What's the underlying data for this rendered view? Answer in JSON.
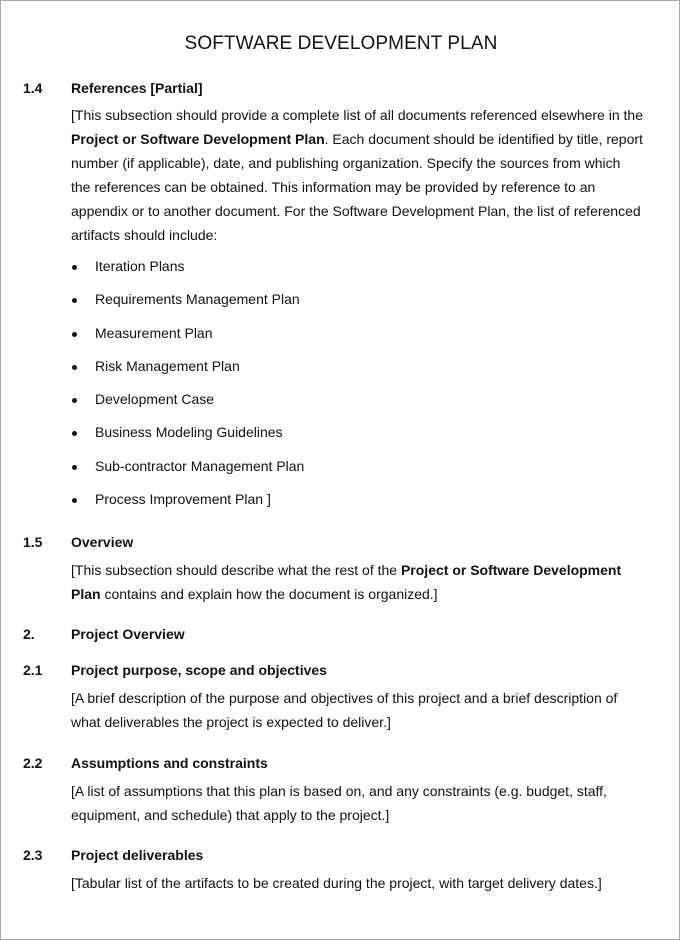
{
  "document": {
    "title": "SOFTWARE DEVELOPMENT PLAN",
    "sections": [
      {
        "number": "1.4",
        "heading": "References [Partial]",
        "lines": [
          [
            {
              "t": "[This subsection should provide a complete list of all documents referenced elsewhere in the",
              "b": false
            }
          ],
          [
            {
              "t": "Project or Software Development Plan",
              "b": true
            },
            {
              "t": ".  Each document should be identified by title, report",
              "b": false
            }
          ],
          [
            {
              "t": "number (if applicable), date,  and publishing organization.  Specify the sources from which",
              "b": false
            }
          ],
          [
            {
              "t": "the references can be obtained. This information may  be provided by reference to an",
              "b": false
            }
          ],
          [
            {
              "t": "appendix or to another document.  For the Software Development Plan,  the list of referenced",
              "b": false
            }
          ],
          [
            {
              "t": "artifacts should include:",
              "b": false
            }
          ]
        ],
        "bullets": [
          "Iteration Plans",
          "Requirements Management Plan",
          "Measurement Plan",
          "Risk Management  Plan",
          "Development Case",
          "Business Modeling Guidelines",
          "Sub-contractor Management Plan",
          "Process Improvement Plan  ]"
        ]
      },
      {
        "number": "1.5",
        "heading": "Overview",
        "lines": [
          [
            {
              "t": "[This subsection should describe what the rest of the ",
              "b": false
            },
            {
              "t": "Project or Software Development",
              "b": true
            }
          ],
          [
            {
              "t": "Plan",
              "b": true
            },
            {
              "t": " contains and explain how the document is organized.]",
              "b": false
            }
          ]
        ]
      },
      {
        "number": "2.",
        "heading": "Project Overview",
        "lines": []
      },
      {
        "number": "2.1",
        "heading": "Project purpose, scope and objectives",
        "lines": [
          [
            {
              "t": "[A brief description of the purpose and objectives of this project and a  brief description of",
              "b": false
            }
          ],
          [
            {
              "t": "what deliverables the project is expected to deliver.]",
              "b": false
            }
          ]
        ]
      },
      {
        "number": "2.2",
        "heading": "Assumptions and constraints",
        "lines": [
          [
            {
              "t": "[A list of assumptions that this plan is based on,  and any  constraints (e.g. budget, staff,",
              "b": false
            }
          ],
          [
            {
              "t": "equipment,  and schedule) that apply to the project.]",
              "b": false
            }
          ]
        ]
      },
      {
        "number": "2.3",
        "heading": "Project deliverables",
        "lines": [
          [
            {
              "t": "[Tabular list of the artifacts to be created during the project, with target delivery dates.]",
              "b": false
            }
          ]
        ]
      }
    ]
  }
}
